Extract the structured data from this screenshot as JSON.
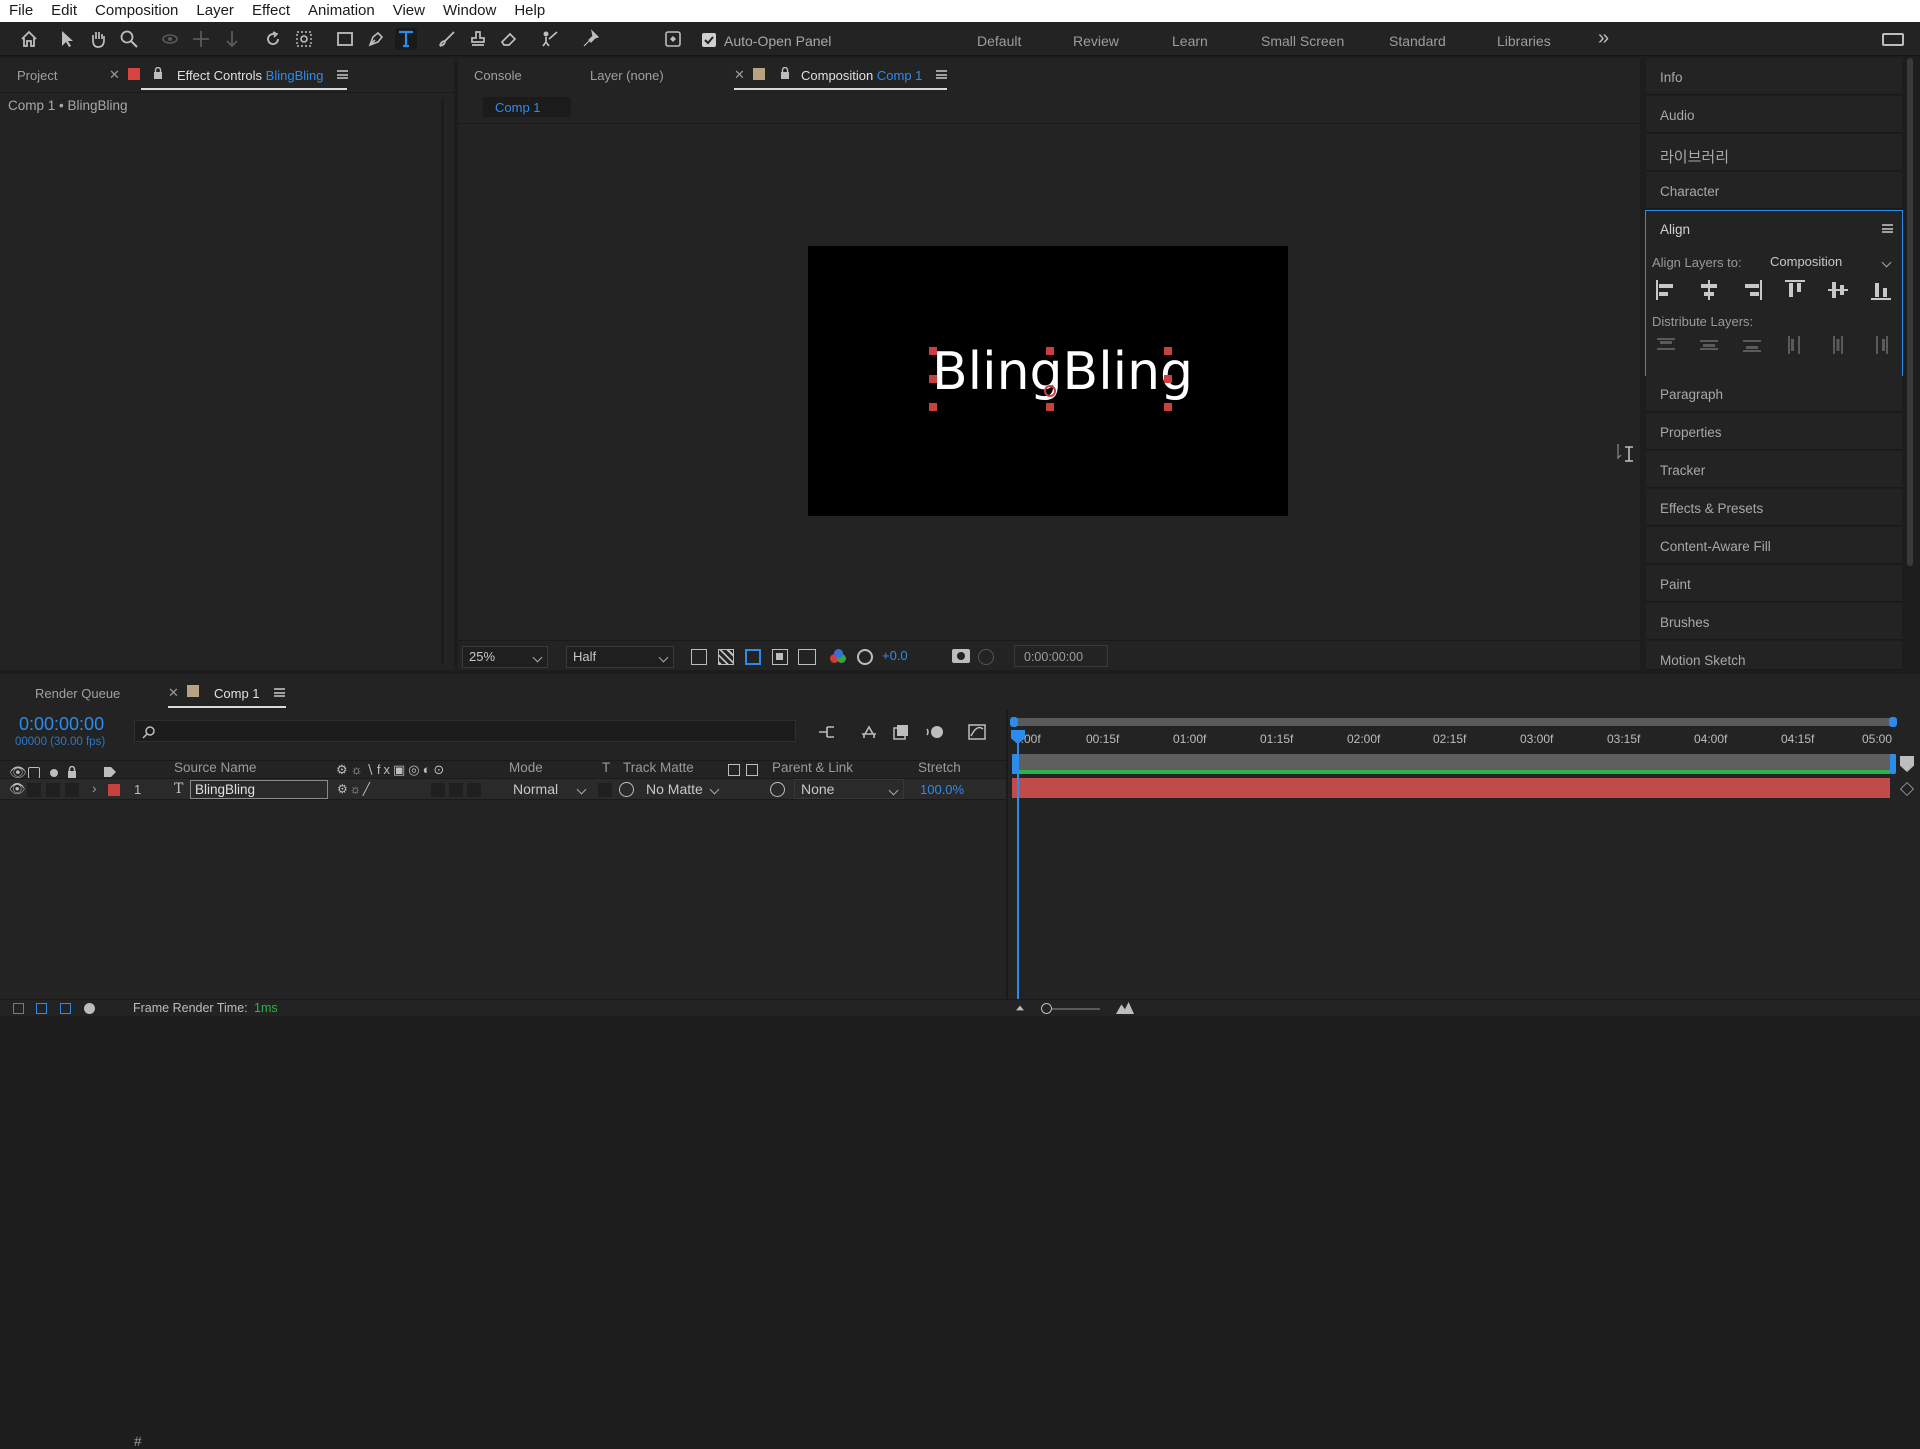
{
  "menu": [
    "File",
    "Edit",
    "Composition",
    "Layer",
    "Effect",
    "Animation",
    "View",
    "Window",
    "Help"
  ],
  "toolbar": {
    "auto_open_label": "Auto-Open Panel",
    "workspaces": [
      "Default",
      "Review",
      "Learn",
      "Small Screen",
      "Standard",
      "Libraries"
    ],
    "more_glyph": "»"
  },
  "left_panel": {
    "tab_project": "Project",
    "tab_effect_controls": "Effect Controls",
    "tab_effect_layer": "BlingBling",
    "breadcrumb": "Comp 1 • BlingBling"
  },
  "viewer": {
    "tab_console": "Console",
    "tab_layer": "Layer (none)",
    "tab_composition": "Composition",
    "tab_comp_name": "Comp 1",
    "crumb": "Comp 1",
    "canvas_text": "BlingBling",
    "zoom": "25%",
    "resolution": "Half",
    "exposure": "+0.0",
    "timecode": "0:00:00:00"
  },
  "right_panel": {
    "items_top": [
      "Info",
      "Audio",
      "라이브러리",
      "Character"
    ],
    "align_title": "Align",
    "align_layers_to_label": "Align Layers to:",
    "align_layers_to_value": "Composition",
    "distribute_label": "Distribute Layers:",
    "items_bottom": [
      "Paragraph",
      "Properties",
      "Tracker",
      "Effects & Presets",
      "Content-Aware Fill",
      "Paint",
      "Brushes",
      "Motion Sketch"
    ]
  },
  "timeline": {
    "tab_render_queue": "Render Queue",
    "tab_comp": "Comp 1",
    "current_time": "0:00:00:00",
    "frame_info": "00000 (30.00 fps)",
    "search_placeholder": "",
    "columns": {
      "num": "#",
      "source_name": "Source Name",
      "mode": "Mode",
      "t": "T",
      "track_matte": "Track Matte",
      "parent_link": "Parent & Link",
      "stretch": "Stretch"
    },
    "ruler": [
      "0:00f",
      "00:15f",
      "01:00f",
      "01:15f",
      "02:00f",
      "02:15f",
      "03:00f",
      "03:15f",
      "04:00f",
      "04:15f",
      "05:00"
    ],
    "layers": [
      {
        "num": "1",
        "type_glyph": "T",
        "name": "BlingBling",
        "mode": "Normal",
        "track_matte": "No Matte",
        "parent": "None",
        "stretch": "100.0%",
        "label_color": "#c8423d"
      }
    ]
  },
  "status": {
    "frame_render_label": "Frame Render Time:",
    "frame_render_value": "1ms"
  },
  "colors": {
    "accent": "#2d8ceb",
    "layer_bar": "#c14a4a",
    "work_area_green": "#2bb24a"
  }
}
